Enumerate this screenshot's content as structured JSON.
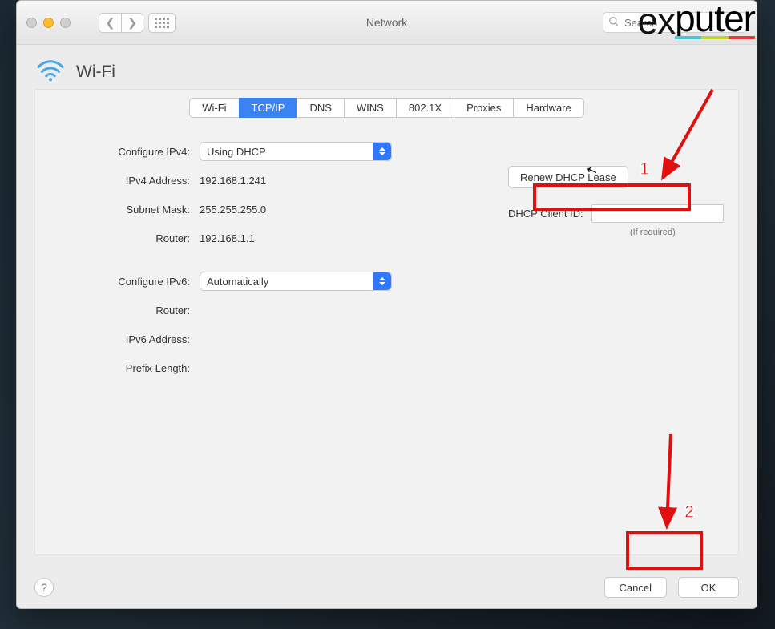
{
  "window": {
    "title": "Network"
  },
  "search": {
    "placeholder": "Search"
  },
  "watermark": "exputer",
  "panel": {
    "icon": "wifi-icon",
    "title": "Wi-Fi"
  },
  "tabs": [
    "Wi-Fi",
    "TCP/IP",
    "DNS",
    "WINS",
    "802.1X",
    "Proxies",
    "Hardware"
  ],
  "active_tab": "TCP/IP",
  "ipv4": {
    "configure_label": "Configure IPv4:",
    "configure_value": "Using DHCP",
    "address_label": "IPv4 Address:",
    "address_value": "192.168.1.241",
    "subnet_label": "Subnet Mask:",
    "subnet_value": "255.255.255.0",
    "router_label": "Router:",
    "router_value": "192.168.1.1"
  },
  "dhcp": {
    "renew_button": "Renew DHCP Lease",
    "client_id_label": "DHCP Client ID:",
    "client_id_value": "",
    "required_hint": "(If required)"
  },
  "ipv6": {
    "configure_label": "Configure IPv6:",
    "configure_value": "Automatically",
    "router_label": "Router:",
    "router_value": "",
    "address_label": "IPv6 Address:",
    "address_value": "",
    "prefix_label": "Prefix Length:",
    "prefix_value": ""
  },
  "footer": {
    "help_tooltip": "?",
    "cancel": "Cancel",
    "ok": "OK"
  },
  "annotations": {
    "step1": "1",
    "step2": "2"
  }
}
